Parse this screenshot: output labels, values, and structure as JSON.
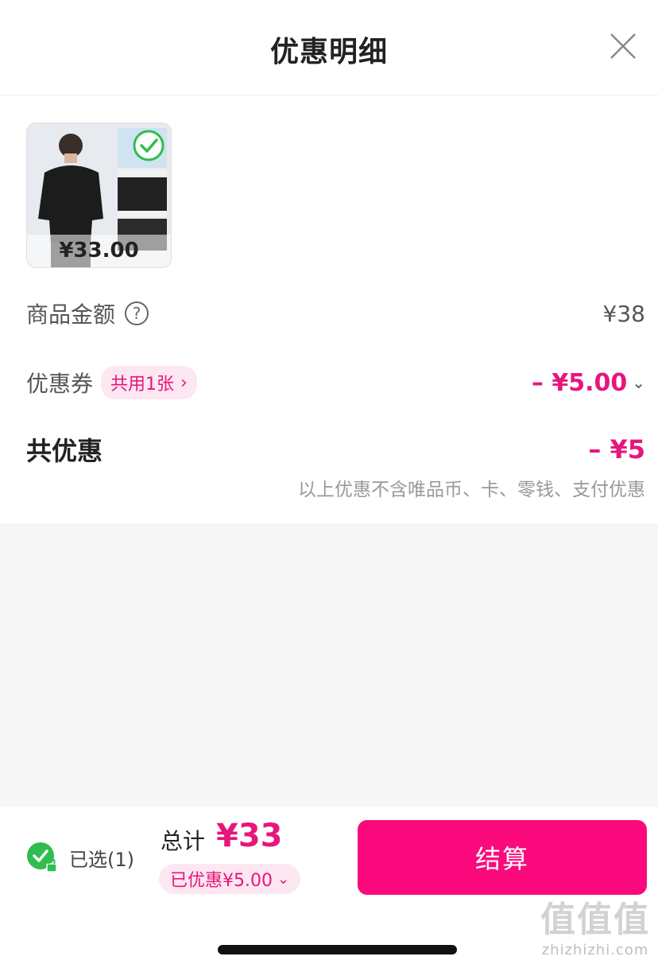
{
  "header": {
    "title": "优惠明细",
    "close_icon": "close-icon"
  },
  "product": {
    "price": "¥33.00",
    "selected_icon": "check-circle-icon"
  },
  "rows": {
    "goods_amount_label": "商品金额",
    "goods_amount_help": "?",
    "goods_amount_value": "¥38",
    "coupon_label": "优惠券",
    "coupon_pill": "共用1张",
    "coupon_value": "– ¥5.00",
    "total_discount_label": "共优惠",
    "total_discount_value": "– ¥5",
    "note": "以上优惠不含唯品币、卡、零钱、支付优惠"
  },
  "footer": {
    "selected_text": "已选(1)",
    "total_label": "总计",
    "total_value": "¥33",
    "discounted_label": "已优惠¥5.00",
    "checkout_label": "结算"
  },
  "watermark": {
    "big": "值值值",
    "small": "zhizhizhi.com"
  },
  "colors": {
    "accent": "#e6167d",
    "checkout_bg": "#fa0a7c",
    "pill_bg": "#fde7f1",
    "check_green": "#2ebd4e"
  }
}
